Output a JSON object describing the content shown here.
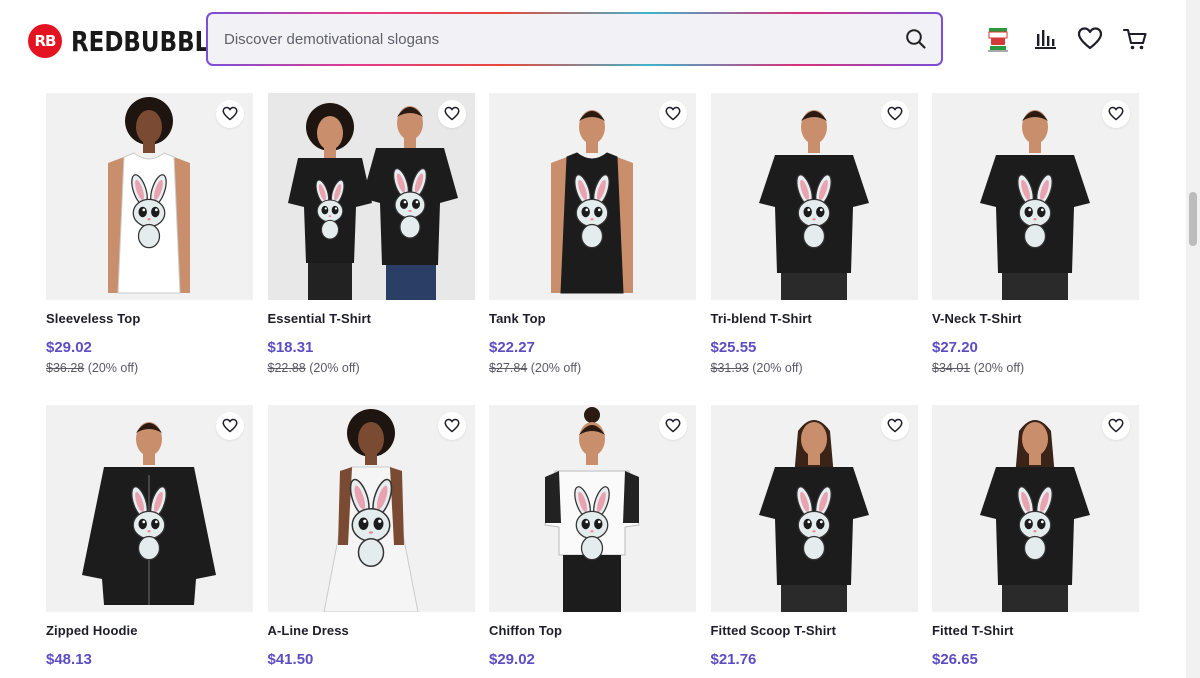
{
  "brand": {
    "mark": "RB",
    "name": "REDBUBBLE",
    "color": "#e41321"
  },
  "search": {
    "placeholder": "Discover demotivational slogans"
  },
  "header_icons": [
    "flag-icon",
    "artist-dashboard-icon",
    "favorites-heart-icon",
    "cart-icon"
  ],
  "accent": "#5b4ec2",
  "products": [
    {
      "name": "Sleeveless Top",
      "price": "$29.02",
      "old_price": "$36.28",
      "discount": "(20% off)",
      "garment": "sleeveless",
      "shirt_color": "#ffffff",
      "model": "woman-afro"
    },
    {
      "name": "Essential T-Shirt",
      "price": "$18.31",
      "old_price": "$22.88",
      "discount": "(20% off)",
      "garment": "tshirt-pair",
      "shirt_color": "#1c1c1c",
      "model": "couple"
    },
    {
      "name": "Tank Top",
      "price": "$22.27",
      "old_price": "$27.84",
      "discount": "(20% off)",
      "garment": "tank",
      "shirt_color": "#1c1c1c",
      "model": "man"
    },
    {
      "name": "Tri-blend T-Shirt",
      "price": "$25.55",
      "old_price": "$31.93",
      "discount": "(20% off)",
      "garment": "tshirt",
      "shirt_color": "#1c1c1c",
      "model": "man"
    },
    {
      "name": "V-Neck T-Shirt",
      "price": "$27.20",
      "old_price": "$34.01",
      "discount": "(20% off)",
      "garment": "vneck",
      "shirt_color": "#1c1c1c",
      "model": "man"
    },
    {
      "name": "Zipped Hoodie",
      "price": "$48.13",
      "old_price": "",
      "discount": "",
      "garment": "hoodie",
      "shirt_color": "#1c1c1c",
      "model": "man"
    },
    {
      "name": "A-Line Dress",
      "price": "$41.50",
      "old_price": "",
      "discount": "",
      "garment": "dress",
      "shirt_color": "#ffffff",
      "model": "woman-afro"
    },
    {
      "name": "Chiffon Top",
      "price": "$29.02",
      "old_price": "",
      "discount": "",
      "garment": "chiffon",
      "shirt_color": "#ffffff",
      "model": "woman"
    },
    {
      "name": "Fitted Scoop T-Shirt",
      "price": "$21.76",
      "old_price": "",
      "discount": "",
      "garment": "scoop",
      "shirt_color": "#1c1c1c",
      "model": "woman-long"
    },
    {
      "name": "Fitted T-Shirt",
      "price": "$26.65",
      "old_price": "",
      "discount": "",
      "garment": "fitted",
      "shirt_color": "#1c1c1c",
      "model": "woman-long"
    }
  ]
}
